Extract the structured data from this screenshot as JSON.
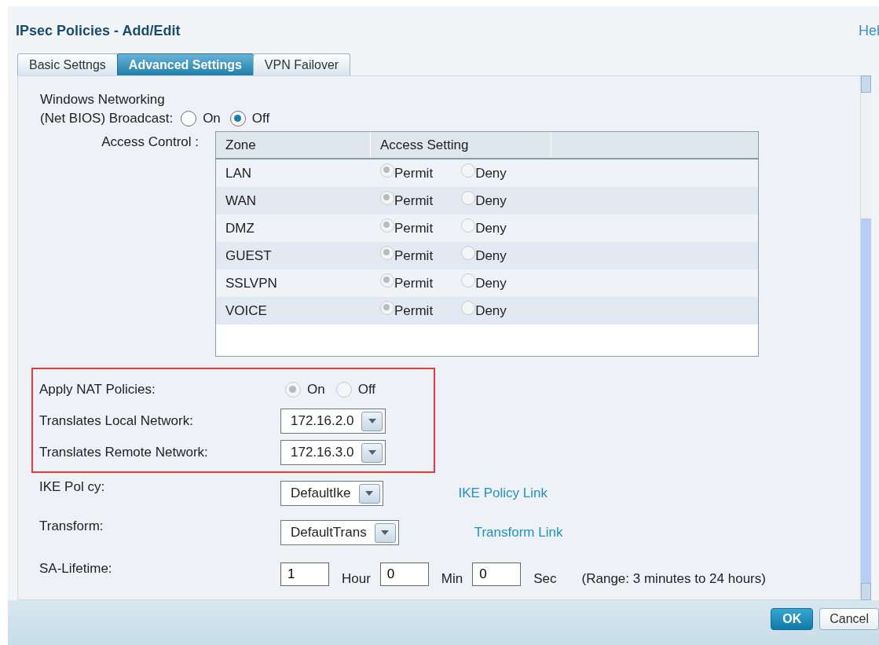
{
  "window": {
    "title": "IPsec Policies - Add/Edit",
    "help_link": "Hel"
  },
  "tabs": [
    {
      "label": "Basic Settngs",
      "selected": false
    },
    {
      "label": "Advanced Settings",
      "selected": true
    },
    {
      "label": "VPN Failover",
      "selected": false
    }
  ],
  "netbios": {
    "label_lines": [
      "Windows Networking",
      "(Net BIOS) Broadcast:"
    ],
    "options": [
      {
        "label": "On",
        "selected": false
      },
      {
        "label": "Off",
        "selected": true
      }
    ]
  },
  "access_control": {
    "label": "Access Control :",
    "columns": [
      "Zone",
      "Access Setting"
    ],
    "rows": [
      {
        "zone": "LAN",
        "options": [
          {
            "label": "Permit",
            "selected": true
          },
          {
            "label": "Deny",
            "selected": false
          }
        ],
        "disabled": true
      },
      {
        "zone": "WAN",
        "options": [
          {
            "label": "Permit",
            "selected": true
          },
          {
            "label": "Deny",
            "selected": false
          }
        ],
        "disabled": true
      },
      {
        "zone": "DMZ",
        "options": [
          {
            "label": "Permit",
            "selected": true
          },
          {
            "label": "Deny",
            "selected": false
          }
        ],
        "disabled": true
      },
      {
        "zone": "GUEST",
        "options": [
          {
            "label": "Permit",
            "selected": true
          },
          {
            "label": "Deny",
            "selected": false
          }
        ],
        "disabled": true
      },
      {
        "zone": "SSLVPN",
        "options": [
          {
            "label": "Permit",
            "selected": true
          },
          {
            "label": "Deny",
            "selected": false
          }
        ],
        "disabled": true
      },
      {
        "zone": "VOICE",
        "options": [
          {
            "label": "Permit",
            "selected": true
          },
          {
            "label": "Deny",
            "selected": false
          }
        ],
        "disabled": true
      }
    ]
  },
  "nat_section": {
    "highlighted": true,
    "rows": [
      {
        "kind": "radio",
        "label": "Apply NAT Policies:",
        "disabled": true,
        "options": [
          {
            "label": "On",
            "selected": true
          },
          {
            "label": "Off",
            "selected": false
          }
        ]
      },
      {
        "kind": "select",
        "label": "Translates Local Network:",
        "value": "172.16.2.0"
      },
      {
        "kind": "select",
        "label": "Translates Remote Network:",
        "value": "172.16.3.0"
      }
    ]
  },
  "rows": [
    {
      "kind": "select",
      "label": "IKE Pol cy:",
      "value": "DefaultIke",
      "link": "IKE Policy Link"
    },
    {
      "kind": "select",
      "label": "Transform:",
      "value": "DefaultTrans",
      "link": "Transform Link"
    },
    {
      "kind": "duration",
      "label": "SA-Lifetime:",
      "fields": [
        {
          "value": "1",
          "unit": "Hour"
        },
        {
          "value": "0",
          "unit": "Min"
        },
        {
          "value": "0",
          "unit": "Sec"
        }
      ],
      "note": "(Range: 3 minutes to 24 hours)"
    }
  ],
  "buttons": [
    {
      "label": "OK",
      "primary": true
    },
    {
      "label": "Cancel",
      "primary": false
    }
  ]
}
